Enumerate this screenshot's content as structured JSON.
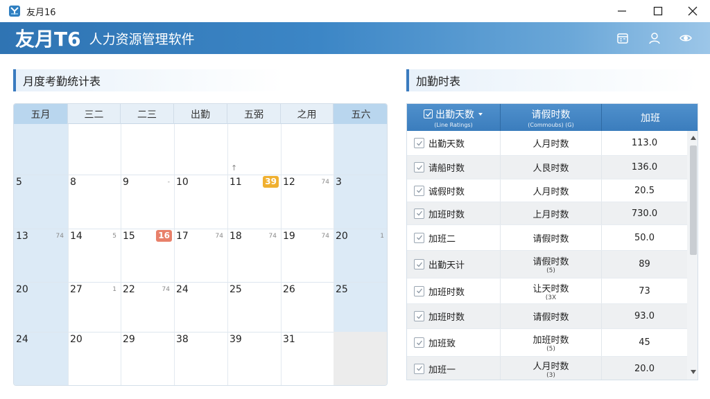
{
  "window": {
    "title": "友月16"
  },
  "header": {
    "brand": "友月T6",
    "subtitle": "人力资源管理软件",
    "icons": [
      "calendar-icon",
      "user-icon",
      "eye-icon"
    ]
  },
  "colors": {
    "header_blue": "#3c86c6",
    "accent": "#3a7bbf",
    "weekend_column": "#dceaf6",
    "badge_orange": "#f0b030",
    "badge_red": "#e8806a"
  },
  "calendar": {
    "title": "月度考勤统计表",
    "headers": [
      "五月",
      "三二",
      "二三",
      "出勤",
      "五弼",
      "之用",
      "五六"
    ],
    "rows": [
      [
        {
          "day": ""
        },
        {
          "day": ""
        },
        {
          "day": ""
        },
        {
          "day": ""
        },
        {
          "day": "",
          "mark": "↑"
        },
        {
          "day": ""
        },
        {
          "day": ""
        }
      ],
      [
        {
          "day": "5"
        },
        {
          "day": "8"
        },
        {
          "day": "9",
          "mark": "-"
        },
        {
          "day": "10"
        },
        {
          "day": "11",
          "badge": "39",
          "badge_color": "#f0b030"
        },
        {
          "day": "12",
          "mark": "74"
        },
        {
          "day": "3"
        }
      ],
      [
        {
          "day": "13",
          "mark": "74"
        },
        {
          "day": "14",
          "mark": "5"
        },
        {
          "day": "15",
          "badge": "16",
          "badge_color": "#e8806a"
        },
        {
          "day": "17",
          "mark": "74"
        },
        {
          "day": "18",
          "mark": "74"
        },
        {
          "day": "19",
          "mark": "74"
        },
        {
          "day": "20",
          "mark": "1"
        }
      ],
      [
        {
          "day": "20"
        },
        {
          "day": "27",
          "mark": "1"
        },
        {
          "day": "22",
          "mark": "74"
        },
        {
          "day": "24"
        },
        {
          "day": "25"
        },
        {
          "day": "26"
        },
        {
          "day": "25"
        }
      ],
      [
        {
          "day": "24"
        },
        {
          "day": "20"
        },
        {
          "day": "29"
        },
        {
          "day": "38"
        },
        {
          "day": "39"
        },
        {
          "day": "31"
        },
        {
          "day": "",
          "empty": true
        }
      ]
    ]
  },
  "overtime": {
    "title": "加勤时表",
    "columns": [
      {
        "label": "出勤天数",
        "sub": "(Line Ratings)",
        "sortable": true
      },
      {
        "label": "请假时数",
        "sub": "(Commoubs) (G)"
      },
      {
        "label": "加班",
        "sub": ""
      }
    ],
    "rows": [
      {
        "name": "出勤天数",
        "type": "人月时数",
        "sub": "",
        "value": "113.0"
      },
      {
        "name": "请船时数",
        "type": "人艮时数",
        "sub": "",
        "value": "136.0"
      },
      {
        "name": "诚假时数",
        "type": "人月时数",
        "sub": "",
        "value": "20.5"
      },
      {
        "name": "加班时数",
        "type": "上月时数",
        "sub": "",
        "value": "730.0"
      },
      {
        "name": "加班二",
        "type": "请假时数",
        "sub": "",
        "value": "50.0"
      },
      {
        "name": "出勤天计",
        "type": "请假时数",
        "sub": "(5)",
        "value": "89"
      },
      {
        "name": "加班时数",
        "type": "让天时数",
        "sub": "(3X",
        "value": "73"
      },
      {
        "name": "加班时数",
        "type": "请假时数",
        "sub": "",
        "value": "93.0"
      },
      {
        "name": "加班致",
        "type": "加班时数",
        "sub": "(5)",
        "value": "45"
      },
      {
        "name": "加班一",
        "type": "人月时数",
        "sub": "(3)",
        "value": "20.0"
      }
    ]
  }
}
